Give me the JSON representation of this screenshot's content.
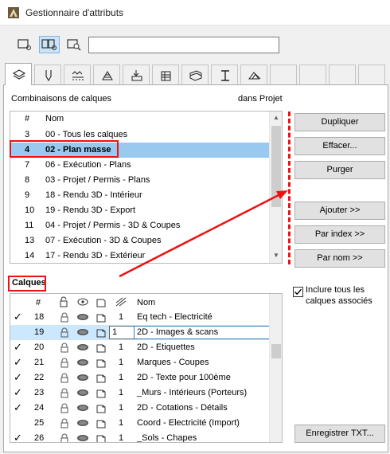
{
  "window": {
    "title": "Gestionnaire d'attributs"
  },
  "search": {
    "value": ""
  },
  "view_buttons": [
    {
      "name": "single-view-icon"
    },
    {
      "name": "dual-view-icon"
    },
    {
      "name": "search-view-icon"
    }
  ],
  "tabs": [
    {
      "name": "tab-layers",
      "icon": "layers-icon",
      "selected": true
    },
    {
      "name": "tab-pens",
      "icon": "pen-icon"
    },
    {
      "name": "tab-lines",
      "icon": "line-types-icon"
    },
    {
      "name": "tab-fills",
      "icon": "fill-icon"
    },
    {
      "name": "tab-composites",
      "icon": "composites-icon"
    },
    {
      "name": "tab-profiles",
      "icon": "profiles-icon"
    },
    {
      "name": "tab-zones",
      "icon": "zones-icon"
    },
    {
      "name": "tab-surfaces",
      "icon": "surfaces-icon"
    },
    {
      "name": "tab-mep",
      "icon": "mep-icon"
    }
  ],
  "combinations": {
    "label": "Combinaisons de calques",
    "context": "dans Projet",
    "header": {
      "num": "#",
      "name": "Nom"
    },
    "rows": [
      {
        "num": "3",
        "name": "00 - Tous les calques"
      },
      {
        "num": "4",
        "name": "02 - Plan masse",
        "selected": true
      },
      {
        "num": "7",
        "name": "06 - Exécution - Plans"
      },
      {
        "num": "8",
        "name": "03 - Projet / Permis - Plans"
      },
      {
        "num": "9",
        "name": "18 - Rendu 3D - Intérieur"
      },
      {
        "num": "10",
        "name": "19 - Rendu 3D - Export"
      },
      {
        "num": "11",
        "name": "04 - Projet / Permis - 3D & Coupes"
      },
      {
        "num": "13",
        "name": "07 - Exécution - 3D & Coupes"
      },
      {
        "num": "14",
        "name": "17 - Rendu 3D - Extérieur"
      }
    ]
  },
  "buttons": {
    "dupliquer": "Dupliquer",
    "effacer": "Effacer...",
    "purger": "Purger",
    "ajouter": "Ajouter >>",
    "par_index": "Par index >>",
    "par_nom": "Par nom >>",
    "enregistrer": "Enregistrer TXT..."
  },
  "layers": {
    "label": "Calques",
    "header": {
      "num": "#",
      "name": "Nom"
    },
    "rows": [
      {
        "check": "✓",
        "num": "18",
        "pen": "1",
        "name": "Eq tech - Electricité"
      },
      {
        "check": "",
        "num": "19",
        "pen": "1",
        "name": "2D - Images & scans",
        "selected": true
      },
      {
        "check": "✓",
        "num": "20",
        "pen": "1",
        "name": "2D - Etiquettes"
      },
      {
        "check": "✓",
        "num": "21",
        "pen": "1",
        "name": "Marques - Coupes"
      },
      {
        "check": "✓",
        "num": "22",
        "pen": "1",
        "name": "2D - Texte pour 100ème"
      },
      {
        "check": "✓",
        "num": "23",
        "pen": "1",
        "name": "_Murs - Intérieurs (Porteurs)"
      },
      {
        "check": "✓",
        "num": "24",
        "pen": "1",
        "name": "2D - Cotations - Détails"
      },
      {
        "check": "",
        "num": "25",
        "pen": "1",
        "name": "Coord - Electricité (Import)"
      },
      {
        "check": "✓",
        "num": "26",
        "pen": "1",
        "name": "_Sols - Chapes"
      }
    ]
  },
  "include_all": {
    "label": "Inclure tous les calques associés",
    "checked": true
  },
  "colors": {
    "selection": "#99c9ef",
    "annotation": "#e11111"
  }
}
